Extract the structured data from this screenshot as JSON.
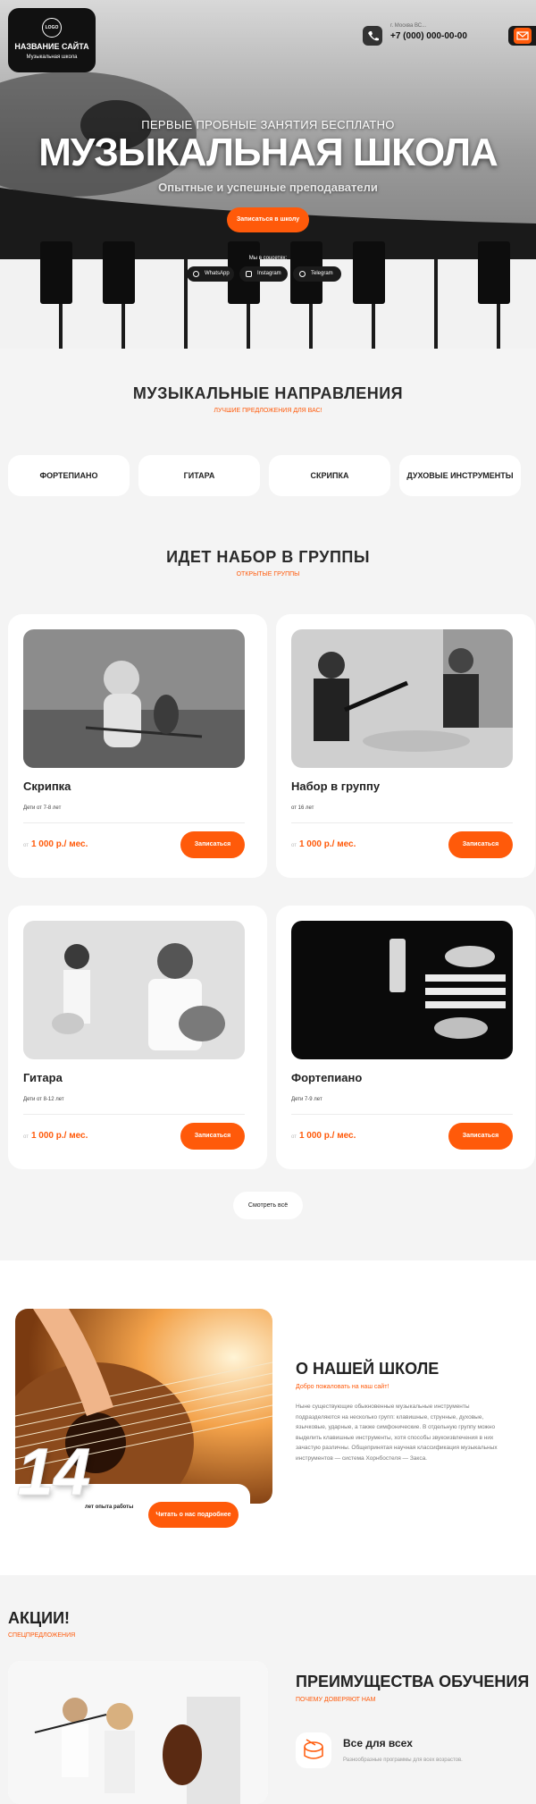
{
  "header": {
    "logo_text": "LOGO",
    "site_name": "НАЗВАНИЕ САЙТА",
    "site_sub": "Музыкальная школа",
    "city": "г. Москва ВС...",
    "phone": "+7 (000) 000-00-00",
    "icons": [
      "phone-icon",
      "mail-icon"
    ]
  },
  "hero": {
    "pre": "ПЕРВЫЕ ПРОБНЫЕ ЗАНЯТИЯ БЕСПЛАТНО",
    "title": "МУЗЫКАЛЬНАЯ ШКОЛА",
    "subtitle": "Опытные и успешные преподаватели",
    "cta": "Записаться в школу",
    "social_label": "Мы в соцсетях:",
    "socials": [
      "WhatsApp",
      "Instagram",
      "Telegram"
    ]
  },
  "directions": {
    "title": "МУЗЫКАЛЬНЫЕ  НАПРАВЛЕНИЯ",
    "subtitle": "ЛУЧШИЕ ПРЕДЛОЖЕНИЯ ДЛЯ ВАС!",
    "items": [
      "ФОРТЕПИАНО",
      "ГИТАРА",
      "СКРИПКА",
      "ДУХОВЫЕ ИНСТРУМЕНТЫ"
    ]
  },
  "groups": {
    "title": "ИДЕТ НАБОР В ГРУППЫ",
    "subtitle": "ОТКРЫТЫЕ ГРУППЫ",
    "price_prefix": "от",
    "cards": [
      {
        "title": "Скрипка",
        "age": "Дети от 7-8 лет",
        "price": "1 000 р./ мес.",
        "button": "Записаться"
      },
      {
        "title": "Набор в группу",
        "age": "от 16 лет",
        "price": "1 000 р./ мес.",
        "button": "Записаться"
      },
      {
        "title": "Гитара",
        "age": "Дети от 8-12 лет",
        "price": "1 000 р./ мес.",
        "button": "Записаться"
      },
      {
        "title": "Фортепиано",
        "age": "Дети 7-9 лет",
        "price": "1 000 р./ мес.",
        "button": "Записаться"
      }
    ],
    "see_all": "Смотреть всё"
  },
  "about": {
    "years": "14",
    "years_label": "лет опыта работы",
    "button": "Читать о нас подробнее",
    "title": "О НАШЕЙ ШКОЛЕ",
    "subtitle": "Добро пожаловать на наш сайт!",
    "text": "Ныне существующие обыкновенные музыкальные инструменты подразделяются на несколько групп: клавишные, струнные, духовые, язычковые, ударные, а также симфонические. В отдельную группу можно выделить клавишные инструменты, хотя способы звукоизвлечения в них зачастую различны. Общепринятая научная классификация музыкальных инструментов — система Хорнбостеля — Закса."
  },
  "promo": {
    "title": "АКЦИИ!",
    "subtitle": "СПЕЦПРЕДЛОЖЕНИЯ"
  },
  "advantages": {
    "title": "ПРЕИМУЩЕСТВА ОБУЧЕНИЯ",
    "subtitle": "ПОЧЕМУ ДОВЕРЯЮТ НАМ",
    "items": [
      {
        "title": "Все для всех",
        "text": "Разнообразные программы для всех возрастов."
      }
    ]
  },
  "colors": {
    "accent": "#ff5a0a",
    "dark": "#1b1b1b",
    "bg": "#f4f4f4"
  }
}
